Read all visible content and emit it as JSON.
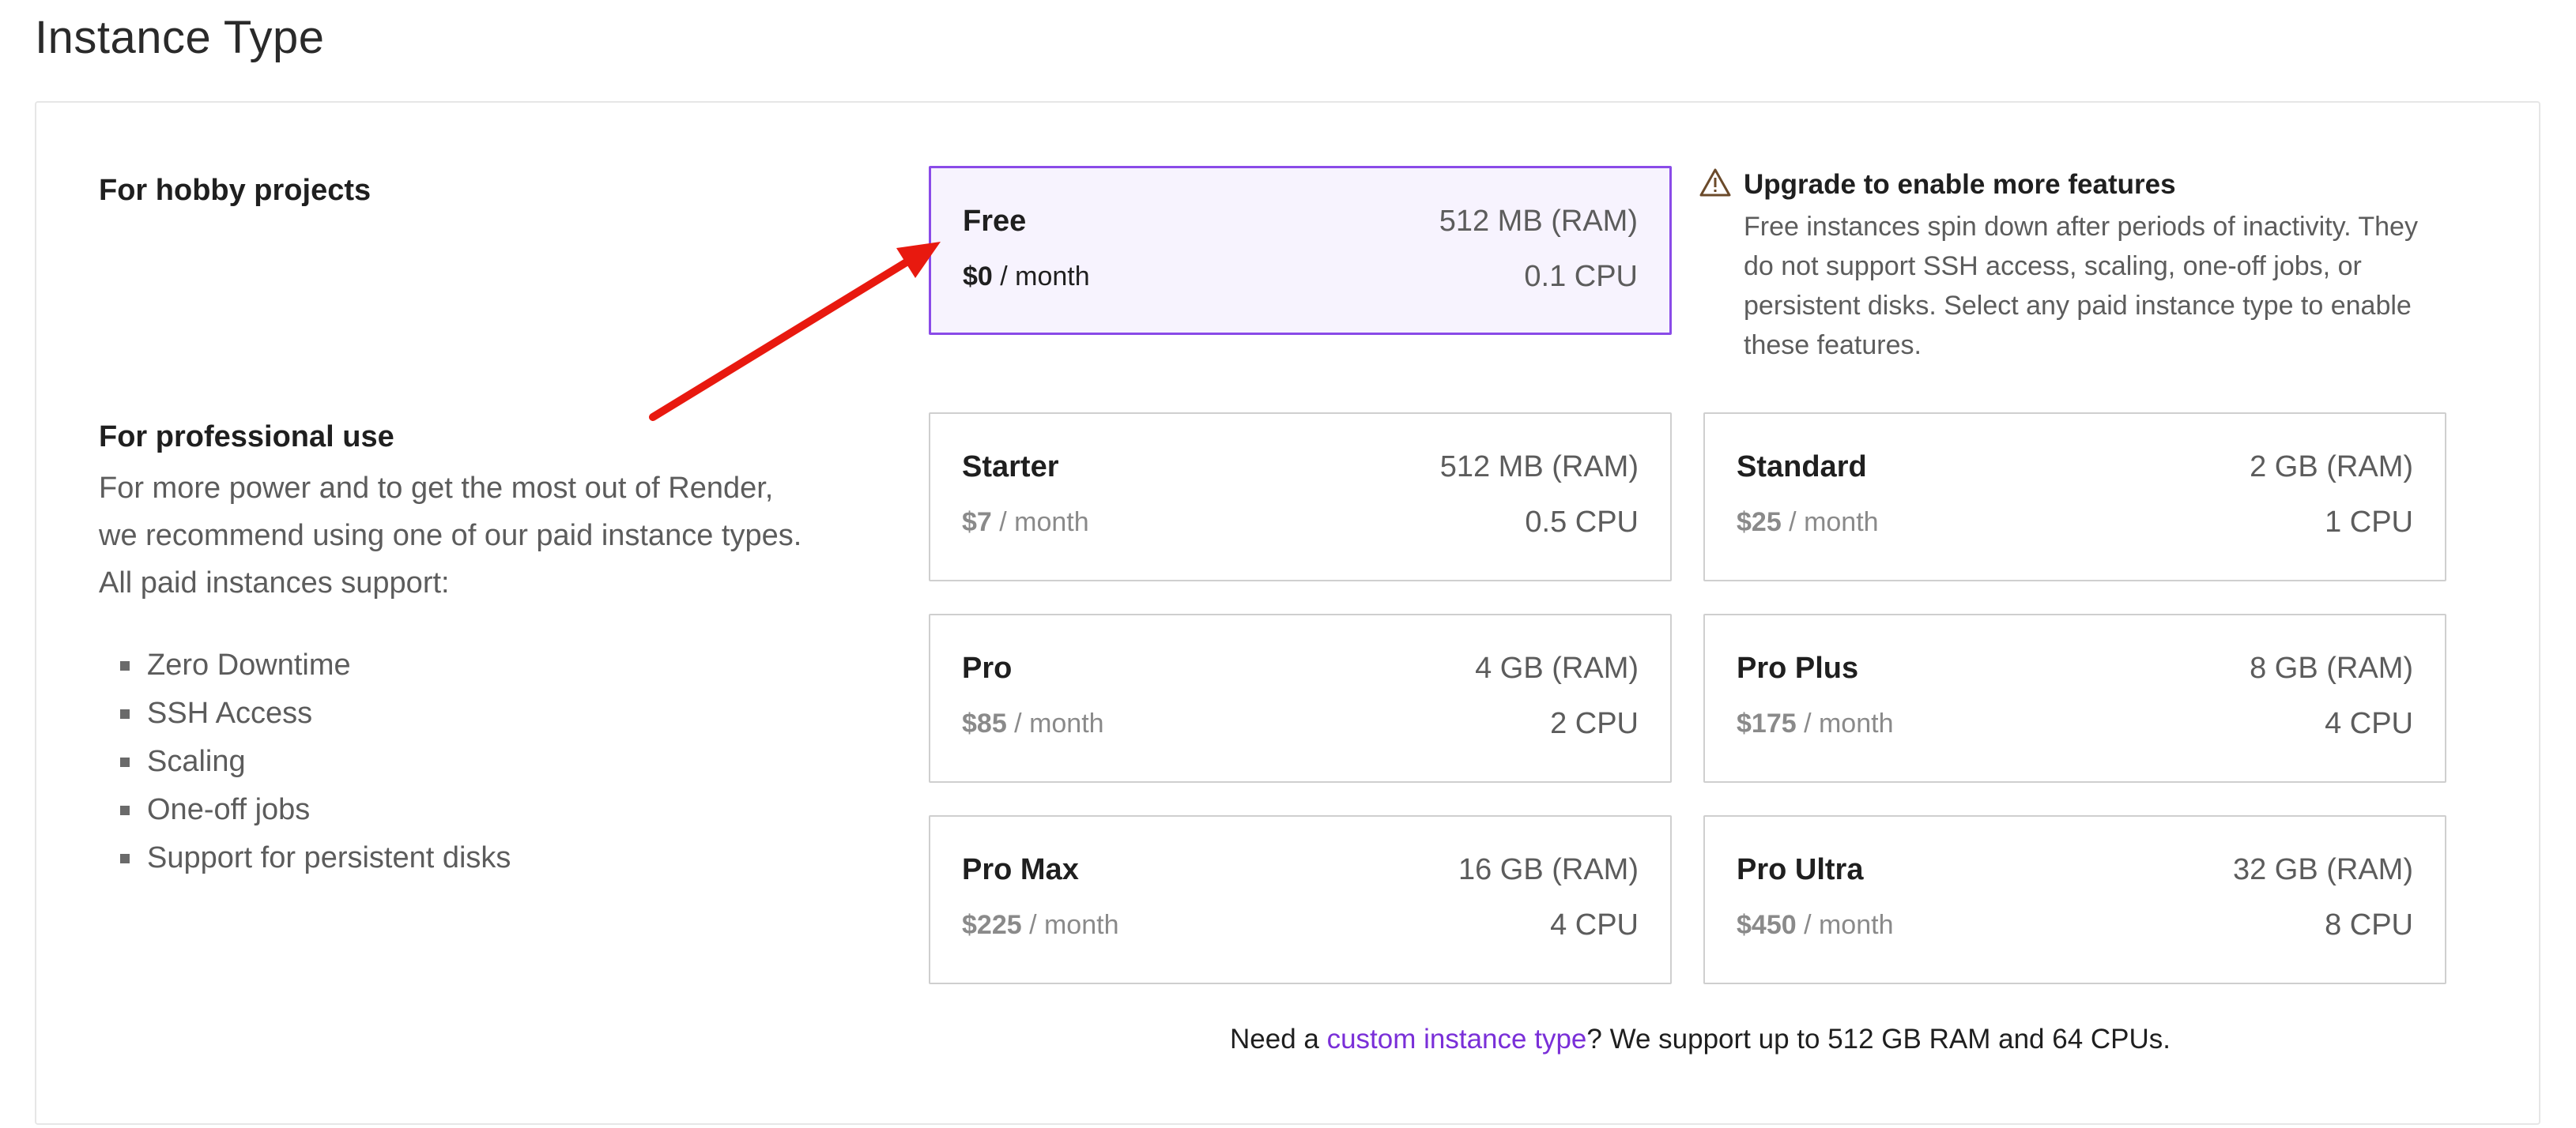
{
  "page": {
    "title": "Instance Type"
  },
  "sections": {
    "hobby": "For hobby projects",
    "professional": "For professional use",
    "professional_description": "For more power and to get the most out of Render, we recommend using one of our paid instance types. All paid instances support:",
    "features": [
      "Zero Downtime",
      "SSH Access",
      "Scaling",
      "One-off jobs",
      "Support for persistent disks"
    ]
  },
  "upgrade_notice": {
    "title": "Upgrade to enable more features",
    "text": "Free instances spin down after periods of inactivity. They do not support SSH access, scaling, one-off jobs, or persistent disks. Select any paid instance type to enable these features.",
    "icon": "warning-triangle-icon"
  },
  "instances": [
    {
      "name": "Free",
      "ram": "512 MB (RAM)",
      "price": "$0",
      "period": " / month",
      "cpu": "0.1 CPU",
      "selected": true
    },
    {
      "name": "Starter",
      "ram": "512 MB (RAM)",
      "price": "$7",
      "period": " / month",
      "cpu": "0.5 CPU"
    },
    {
      "name": "Standard",
      "ram": "2 GB (RAM)",
      "price": "$25",
      "period": " / month",
      "cpu": "1 CPU"
    },
    {
      "name": "Pro",
      "ram": "4 GB (RAM)",
      "price": "$85",
      "period": " / month",
      "cpu": "2 CPU"
    },
    {
      "name": "Pro Plus",
      "ram": "8 GB (RAM)",
      "price": "$175",
      "period": " / month",
      "cpu": "4 CPU"
    },
    {
      "name": "Pro Max",
      "ram": "16 GB (RAM)",
      "price": "$225",
      "period": " / month",
      "cpu": "4 CPU"
    },
    {
      "name": "Pro Ultra",
      "ram": "32 GB (RAM)",
      "price": "$450",
      "period": " / month",
      "cpu": "8 CPU"
    }
  ],
  "footer": {
    "prefix": "Need a ",
    "link": "custom instance type",
    "suffix": "? We support up to 512 GB RAM and 64 CPUs."
  },
  "colors": {
    "accent": "#8a4be8",
    "selected_bg": "#f7f3fe",
    "link": "#7a2fd8",
    "annotation_arrow": "#e8190f"
  }
}
